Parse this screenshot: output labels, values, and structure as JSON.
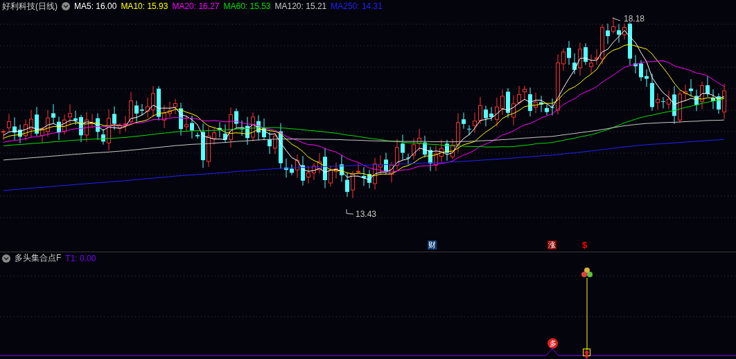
{
  "header": {
    "title": "好利科技(日线)",
    "indicators": [
      {
        "label": "MA5: 16.00",
        "color": "#ffffff"
      },
      {
        "label": "MA10: 15.93",
        "color": "#ffff00"
      },
      {
        "label": "MA20: 16.27",
        "color": "#ff00ff"
      },
      {
        "label": "MA60: 15.53",
        "color": "#00e000"
      },
      {
        "label": "MA120: 15.21",
        "color": "#c8c8c8"
      },
      {
        "label": "MA250: 14.31",
        "color": "#2020ff"
      }
    ]
  },
  "price_chart": {
    "high_label": "18.18",
    "low_label": "13.43",
    "markers": [
      {
        "kind": "badge",
        "text": "财",
        "color": "#0f3f73"
      },
      {
        "kind": "badge",
        "text": "涨",
        "color": "#8a0000"
      },
      {
        "kind": "glyph",
        "text": "$",
        "color": "#ff0000"
      }
    ]
  },
  "indicator_panel": {
    "title": "多头集合点F",
    "values": [
      {
        "label": "T1: 0.00",
        "color": "#7b00ff"
      }
    ],
    "signal_badge": "多"
  }
}
